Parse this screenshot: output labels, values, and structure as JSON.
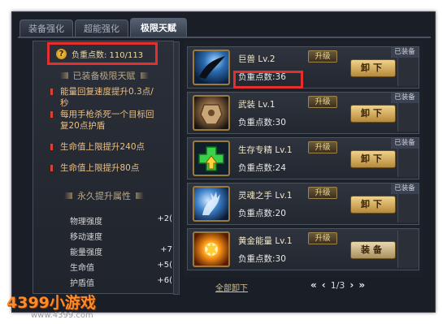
{
  "tabs": [
    {
      "label": "装备强化",
      "active": false
    },
    {
      "label": "超能强化",
      "active": false
    },
    {
      "label": "极限天赋",
      "active": true
    }
  ],
  "left": {
    "weight_label": "负重点数: 110/113",
    "equipped_bonus_title": "已装备极限天赋",
    "bonuses": [
      "能量回复速度提升0.3点/秒",
      "每用手枪杀死一个目标回复20点护盾",
      "生命值上限提升240点",
      "生命值上限提升80点"
    ],
    "permanent_title": "永久提升属性",
    "attributes": [
      {
        "name": "物理强度",
        "value": "+2("
      },
      {
        "name": "移动速度",
        "value": ""
      },
      {
        "name": "能量强度",
        "value": "+7"
      },
      {
        "name": "生命值",
        "value": "+5("
      },
      {
        "name": "护盾值",
        "value": "+6("
      }
    ]
  },
  "cards": [
    {
      "name": "巨兽 Lv.2",
      "weight": "负重点数:36",
      "upgrade": "升级",
      "action": "卸下",
      "equipped": "已装备"
    },
    {
      "name": "武装 Lv.1",
      "weight": "负重点数:30",
      "upgrade": "升级",
      "action": "卸下",
      "equipped": "已装备"
    },
    {
      "name": "生存专精 Lv.1",
      "weight": "负重点数:24",
      "upgrade": "升级",
      "action": "卸下",
      "equipped": "已装备"
    },
    {
      "name": "灵魂之手 Lv.1",
      "weight": "负重点数:20",
      "upgrade": "升级",
      "action": "卸下",
      "equipped": "已装备"
    },
    {
      "name": "黄金能量 Lv.1",
      "weight": "负重点数:30",
      "upgrade": "升级",
      "action": "装备",
      "equipped": ""
    }
  ],
  "footer": {
    "unequip_all": "全部卸下",
    "page": "1/3"
  },
  "watermark": {
    "logo": "4399小游戏",
    "url": "www.4399.com"
  }
}
